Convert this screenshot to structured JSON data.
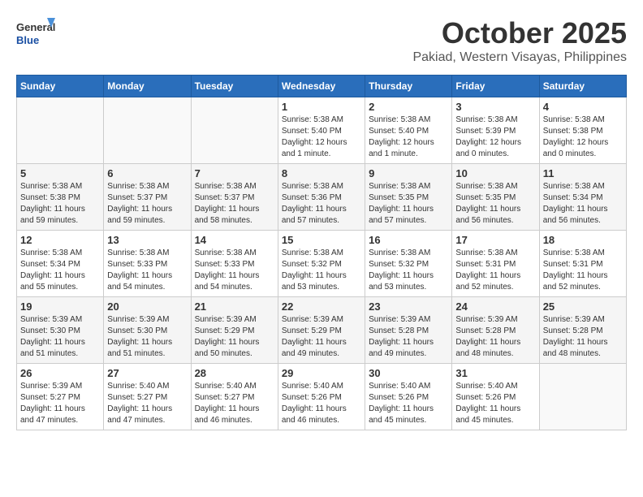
{
  "logo": {
    "general": "General",
    "blue": "Blue"
  },
  "header": {
    "month_year": "October 2025",
    "location": "Pakiad, Western Visayas, Philippines"
  },
  "weekdays": [
    "Sunday",
    "Monday",
    "Tuesday",
    "Wednesday",
    "Thursday",
    "Friday",
    "Saturday"
  ],
  "weeks": [
    [
      {
        "day": "",
        "info": ""
      },
      {
        "day": "",
        "info": ""
      },
      {
        "day": "",
        "info": ""
      },
      {
        "day": "1",
        "info": "Sunrise: 5:38 AM\nSunset: 5:40 PM\nDaylight: 12 hours\nand 1 minute."
      },
      {
        "day": "2",
        "info": "Sunrise: 5:38 AM\nSunset: 5:40 PM\nDaylight: 12 hours\nand 1 minute."
      },
      {
        "day": "3",
        "info": "Sunrise: 5:38 AM\nSunset: 5:39 PM\nDaylight: 12 hours\nand 0 minutes."
      },
      {
        "day": "4",
        "info": "Sunrise: 5:38 AM\nSunset: 5:38 PM\nDaylight: 12 hours\nand 0 minutes."
      }
    ],
    [
      {
        "day": "5",
        "info": "Sunrise: 5:38 AM\nSunset: 5:38 PM\nDaylight: 11 hours\nand 59 minutes."
      },
      {
        "day": "6",
        "info": "Sunrise: 5:38 AM\nSunset: 5:37 PM\nDaylight: 11 hours\nand 59 minutes."
      },
      {
        "day": "7",
        "info": "Sunrise: 5:38 AM\nSunset: 5:37 PM\nDaylight: 11 hours\nand 58 minutes."
      },
      {
        "day": "8",
        "info": "Sunrise: 5:38 AM\nSunset: 5:36 PM\nDaylight: 11 hours\nand 57 minutes."
      },
      {
        "day": "9",
        "info": "Sunrise: 5:38 AM\nSunset: 5:35 PM\nDaylight: 11 hours\nand 57 minutes."
      },
      {
        "day": "10",
        "info": "Sunrise: 5:38 AM\nSunset: 5:35 PM\nDaylight: 11 hours\nand 56 minutes."
      },
      {
        "day": "11",
        "info": "Sunrise: 5:38 AM\nSunset: 5:34 PM\nDaylight: 11 hours\nand 56 minutes."
      }
    ],
    [
      {
        "day": "12",
        "info": "Sunrise: 5:38 AM\nSunset: 5:34 PM\nDaylight: 11 hours\nand 55 minutes."
      },
      {
        "day": "13",
        "info": "Sunrise: 5:38 AM\nSunset: 5:33 PM\nDaylight: 11 hours\nand 54 minutes."
      },
      {
        "day": "14",
        "info": "Sunrise: 5:38 AM\nSunset: 5:33 PM\nDaylight: 11 hours\nand 54 minutes."
      },
      {
        "day": "15",
        "info": "Sunrise: 5:38 AM\nSunset: 5:32 PM\nDaylight: 11 hours\nand 53 minutes."
      },
      {
        "day": "16",
        "info": "Sunrise: 5:38 AM\nSunset: 5:32 PM\nDaylight: 11 hours\nand 53 minutes."
      },
      {
        "day": "17",
        "info": "Sunrise: 5:38 AM\nSunset: 5:31 PM\nDaylight: 11 hours\nand 52 minutes."
      },
      {
        "day": "18",
        "info": "Sunrise: 5:38 AM\nSunset: 5:31 PM\nDaylight: 11 hours\nand 52 minutes."
      }
    ],
    [
      {
        "day": "19",
        "info": "Sunrise: 5:39 AM\nSunset: 5:30 PM\nDaylight: 11 hours\nand 51 minutes."
      },
      {
        "day": "20",
        "info": "Sunrise: 5:39 AM\nSunset: 5:30 PM\nDaylight: 11 hours\nand 51 minutes."
      },
      {
        "day": "21",
        "info": "Sunrise: 5:39 AM\nSunset: 5:29 PM\nDaylight: 11 hours\nand 50 minutes."
      },
      {
        "day": "22",
        "info": "Sunrise: 5:39 AM\nSunset: 5:29 PM\nDaylight: 11 hours\nand 49 minutes."
      },
      {
        "day": "23",
        "info": "Sunrise: 5:39 AM\nSunset: 5:28 PM\nDaylight: 11 hours\nand 49 minutes."
      },
      {
        "day": "24",
        "info": "Sunrise: 5:39 AM\nSunset: 5:28 PM\nDaylight: 11 hours\nand 48 minutes."
      },
      {
        "day": "25",
        "info": "Sunrise: 5:39 AM\nSunset: 5:28 PM\nDaylight: 11 hours\nand 48 minutes."
      }
    ],
    [
      {
        "day": "26",
        "info": "Sunrise: 5:39 AM\nSunset: 5:27 PM\nDaylight: 11 hours\nand 47 minutes."
      },
      {
        "day": "27",
        "info": "Sunrise: 5:40 AM\nSunset: 5:27 PM\nDaylight: 11 hours\nand 47 minutes."
      },
      {
        "day": "28",
        "info": "Sunrise: 5:40 AM\nSunset: 5:27 PM\nDaylight: 11 hours\nand 46 minutes."
      },
      {
        "day": "29",
        "info": "Sunrise: 5:40 AM\nSunset: 5:26 PM\nDaylight: 11 hours\nand 46 minutes."
      },
      {
        "day": "30",
        "info": "Sunrise: 5:40 AM\nSunset: 5:26 PM\nDaylight: 11 hours\nand 45 minutes."
      },
      {
        "day": "31",
        "info": "Sunrise: 5:40 AM\nSunset: 5:26 PM\nDaylight: 11 hours\nand 45 minutes."
      },
      {
        "day": "",
        "info": ""
      }
    ]
  ]
}
